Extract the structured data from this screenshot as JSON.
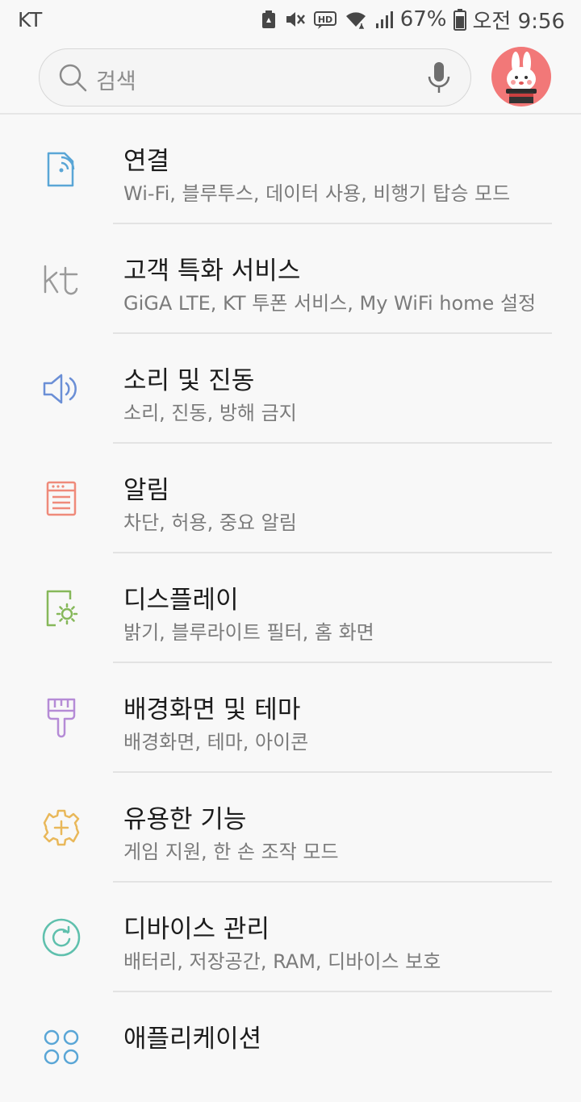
{
  "status_bar": {
    "carrier": "KT",
    "battery_percent": "67%",
    "time": "오전 9:56",
    "icons": [
      "recycle-icon",
      "mute-icon",
      "hd-icon",
      "wifi-icon",
      "signal-icon",
      "battery-icon"
    ]
  },
  "search": {
    "placeholder": "검색",
    "icons": [
      "search-icon",
      "mic-icon"
    ]
  },
  "settings": [
    {
      "title": "연결",
      "subtitle": "Wi-Fi, 블루투스, 데이터 사용, 비행기 탑승 모드",
      "icon": "connection-icon",
      "color": "#5aa6d6"
    },
    {
      "title": "고객 특화 서비스",
      "subtitle": "GiGA LTE, KT 투폰 서비스, My WiFi home 설정",
      "icon": "kt-icon",
      "color": "#9a9a9a"
    },
    {
      "title": "소리 및 진동",
      "subtitle": "소리, 진동, 방해 금지",
      "icon": "speaker-icon",
      "color": "#6b8fd6"
    },
    {
      "title": "알림",
      "subtitle": "차단, 허용, 중요 알림",
      "icon": "notification-icon",
      "color": "#ef8a7a"
    },
    {
      "title": "디스플레이",
      "subtitle": "밝기, 블루라이트 필터, 홈 화면",
      "icon": "display-icon",
      "color": "#86b85a"
    },
    {
      "title": "배경화면 및 테마",
      "subtitle": "배경화면, 테마, 아이콘",
      "icon": "paintbrush-icon",
      "color": "#b58bd6"
    },
    {
      "title": "유용한 기능",
      "subtitle": "게임 지원, 한 손 조작 모드",
      "icon": "gear-plus-icon",
      "color": "#e9b85a"
    },
    {
      "title": "디바이스 관리",
      "subtitle": "배터리, 저장공간, RAM, 디바이스 보호",
      "icon": "device-care-icon",
      "color": "#5fc0ad"
    },
    {
      "title": "애플리케이션",
      "subtitle": "",
      "icon": "apps-icon",
      "color": "#5aa6d6"
    }
  ]
}
